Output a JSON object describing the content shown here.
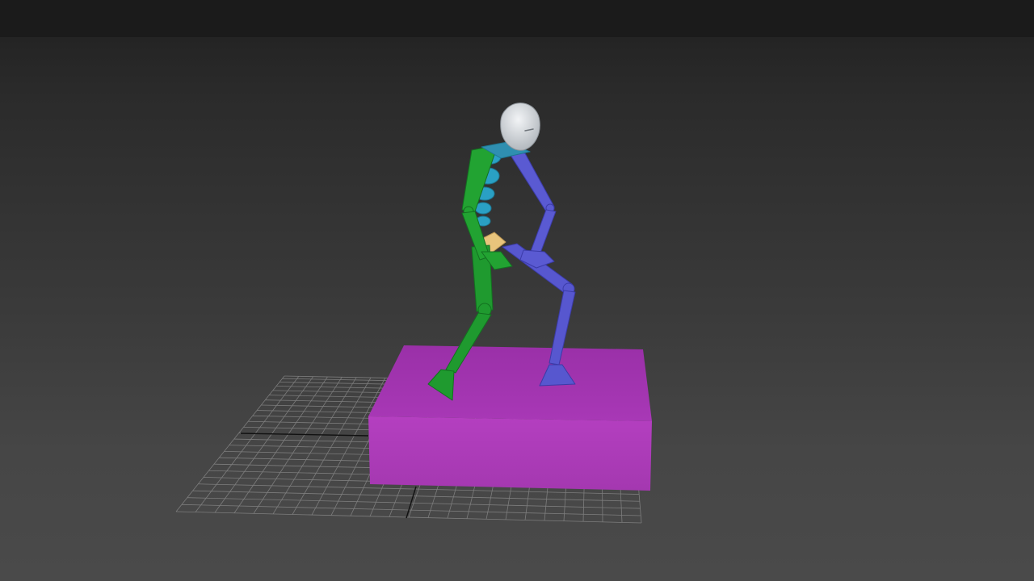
{
  "viewport": {
    "label": "",
    "background_top": "#1e1e1e",
    "background_bottom": "#4a4a4a"
  },
  "scene": {
    "objects": [
      {
        "name": "ground-grid",
        "type": "grid",
        "color": "#8a8a8a"
      },
      {
        "name": "box",
        "type": "box",
        "color": "#b040c0"
      },
      {
        "name": "biped",
        "type": "character-rig",
        "colors": {
          "head": "#d8dde2",
          "left-side": "#1f9a2f",
          "right-side": "#5a5ad0",
          "spine": "#2a9fc0",
          "pelvis": "#e8c680"
        }
      }
    ]
  }
}
